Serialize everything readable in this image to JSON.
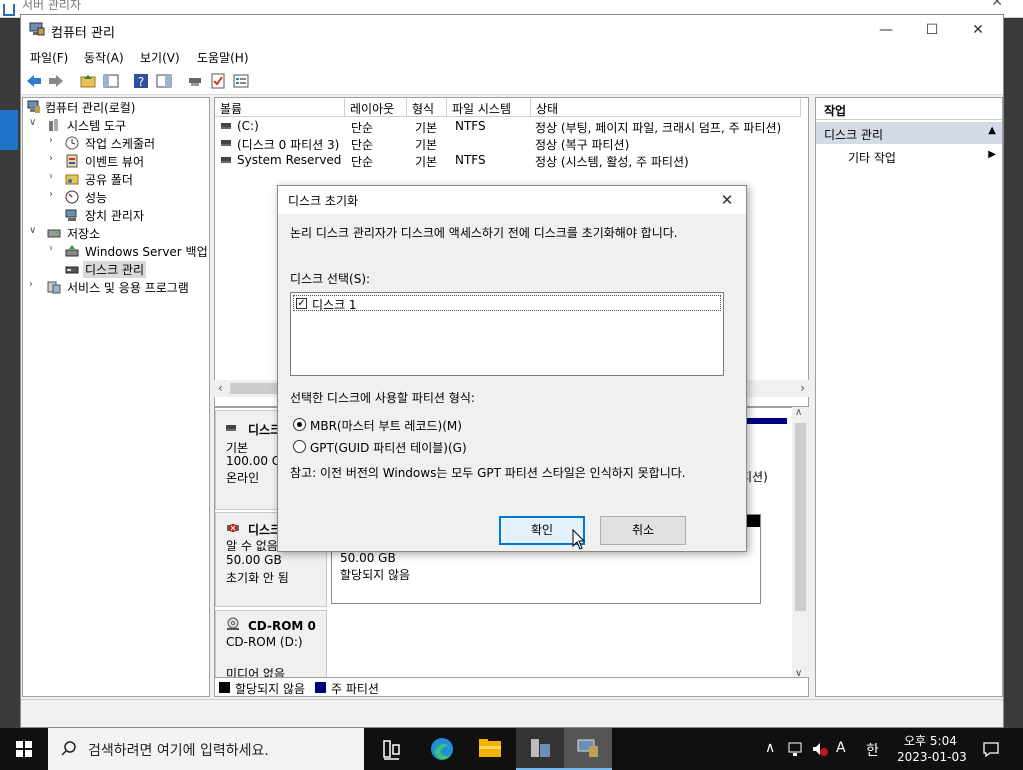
{
  "background_window": {
    "title": "서버 관리자"
  },
  "window": {
    "title": "컴퓨터 관리",
    "controls": {
      "minimize": "—",
      "maximize": "☐",
      "close": "✕"
    }
  },
  "menu": [
    "파일(F)",
    "동작(A)",
    "보기(V)",
    "도움말(H)"
  ],
  "tree": {
    "root": "컴퓨터 관리(로컬)",
    "system_tools": "시스템 도구",
    "task_scheduler": "작업 스케줄러",
    "event_viewer": "이벤트 뷰어",
    "shared_folders": "공유 폴더",
    "performance": "성능",
    "device_manager": "장치 관리자",
    "storage": "저장소",
    "windows_server_backup": "Windows Server 백업",
    "disk_management": "디스크 관리",
    "services_apps": "서비스 및 응용 프로그램"
  },
  "volumes": {
    "columns": [
      "볼륨",
      "레이아웃",
      "형식",
      "파일 시스템",
      "상태"
    ],
    "rows": [
      {
        "name": "(C:)",
        "layout": "단순",
        "type": "기본",
        "fs": "NTFS",
        "status": "정상 (부팅, 페이지 파일, 크래시 덤프, 주 파티션)"
      },
      {
        "name": "(디스크 0 파티션 3)",
        "layout": "단순",
        "type": "기본",
        "fs": "",
        "status": "정상 (복구 파티션)"
      },
      {
        "name": "System Reserved",
        "layout": "단순",
        "type": "기본",
        "fs": "NTFS",
        "status": "정상 (시스템, 활성, 주 파티션)"
      }
    ]
  },
  "disks": {
    "disk0": {
      "name": "디스크",
      "type": "기본",
      "size": "100.00 GB",
      "state": "온라인",
      "partial": "티션)"
    },
    "disk1": {
      "name": "디스크",
      "type": "알 수 없음",
      "size": "50.00 GB",
      "state": "초기화 안 됨",
      "unalloc_size": "50.00 GB",
      "unalloc_label": "할당되지 않음"
    },
    "cdrom": {
      "name": "CD-ROM 0",
      "drive": "CD-ROM (D:)",
      "state": "미디어 없음"
    }
  },
  "legend": [
    {
      "label": "할당되지 않음",
      "color": "#000000"
    },
    {
      "label": "주 파티션",
      "color": "#00007f"
    }
  ],
  "actions": {
    "header": "작업",
    "item": "디스크 관리",
    "sub": "기타 작업"
  },
  "dialog": {
    "title": "디스크 초기화",
    "message": "논리 디스크 관리자가 디스크에 액세스하기 전에 디스크를 초기화해야 합니다.",
    "select_label": "디스크 선택(S):",
    "disk_item": "디스크 1",
    "format_label": "선택한 디스크에 사용할 파티션 형식:",
    "mbr": "MBR(마스터 부트 레코드)(M)",
    "gpt": "GPT(GUID 파티션 테이블)(G)",
    "note": "참고: 이전 버전의 Windows는 모두 GPT 파티션 스타일은 인식하지 못합니다.",
    "ok": "확인",
    "cancel": "취소"
  },
  "taskbar": {
    "search_placeholder": "검색하려면 여기에 입력하세요.",
    "ime_lang": "A",
    "ime_mode": "한",
    "time": "오후 5:04",
    "date": "2023-01-03"
  },
  "colors": {
    "accent": "#0078d7",
    "primary_partition": "#00007f",
    "unallocated": "#000000"
  }
}
